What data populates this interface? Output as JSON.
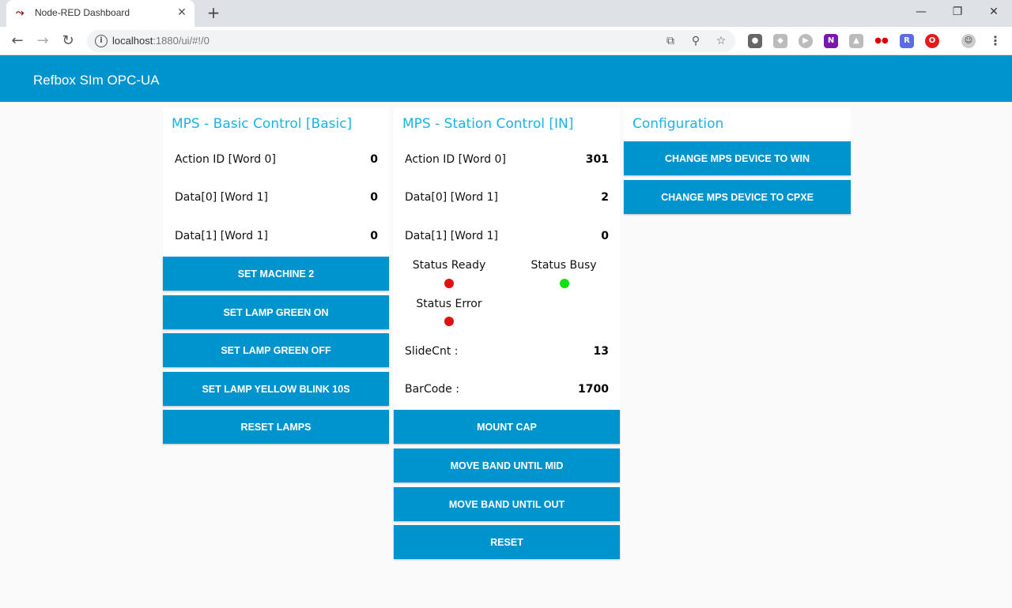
{
  "browser": {
    "tab_title": "Node-RED Dashboard",
    "tab_close": "✕",
    "new_tab": "+",
    "url_host": "localhost",
    "url_rest": ":1880/ui/#!/0",
    "window_minimize": "—",
    "window_restore": "❐",
    "window_close": "✕"
  },
  "app": {
    "title": "Refbox SIm OPC-UA"
  },
  "basic": {
    "title": "MPS - Basic Control [Basic]",
    "rows": [
      {
        "label": "Action ID [Word 0]",
        "value": "0"
      },
      {
        "label": "Data[0] [Word 1]",
        "value": "0"
      },
      {
        "label": "Data[1] [Word 1]",
        "value": "0"
      }
    ],
    "buttons": [
      "SET MACHINE 2",
      "SET LAMP GREEN ON",
      "SET LAMP GREEN OFF",
      "SET LAMP YELLOW BLINK 10S",
      "RESET LAMPS"
    ]
  },
  "station": {
    "title": "MPS - Station Control [IN]",
    "rows": [
      {
        "label": "Action ID [Word 0]",
        "value": "301"
      },
      {
        "label": "Data[0] [Word 1]",
        "value": "2"
      },
      {
        "label": "Data[1] [Word 1]",
        "value": "0"
      }
    ],
    "status": {
      "ready": {
        "label": "Status Ready",
        "color": "#e01010"
      },
      "busy": {
        "label": "Status Busy",
        "color": "#10e010"
      },
      "error": {
        "label": "Status Error",
        "color": "#e01010"
      }
    },
    "slidecnt": {
      "label": "SlideCnt :",
      "value": "13"
    },
    "barcode": {
      "label": "BarCode :",
      "value": "1700"
    },
    "buttons": [
      "MOUNT CAP",
      "MOVE BAND UNTIL MID",
      "MOVE BAND UNTIL OUT",
      "RESET"
    ]
  },
  "config": {
    "title": "Configuration",
    "buttons": [
      "CHANGE MPS DEVICE TO WIN",
      "CHANGE MPS DEVICE TO CPXE"
    ]
  },
  "colors": {
    "accent": "#0094ce",
    "title": "#1bb3e6"
  }
}
